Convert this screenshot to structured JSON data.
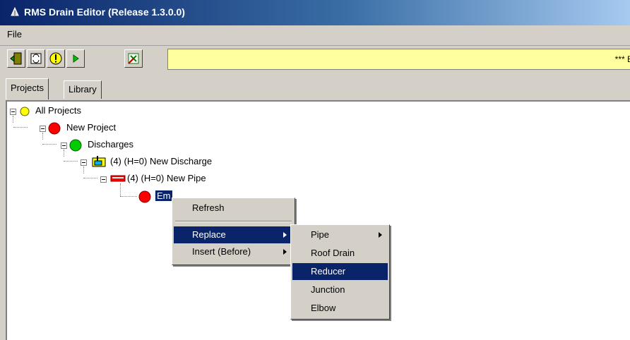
{
  "window": {
    "title": "RMS Drain Editor (Release 1.3.0.0)"
  },
  "menubar": {
    "file": "File"
  },
  "toolbar": {
    "message": "*** Er"
  },
  "tabs": [
    {
      "label": "Projects"
    },
    {
      "label": "Library"
    }
  ],
  "tree": {
    "all_projects": "All Projects",
    "new_project": "New Project",
    "discharges": "Discharges",
    "new_discharge": "(4) (H=0) New Discharge",
    "new_pipe": "(4) (H=0) New Pipe",
    "selected": "Em"
  },
  "context_menu": {
    "refresh": "Refresh",
    "replace": "Replace",
    "insert_before": "Insert (Before)"
  },
  "replace_submenu": {
    "pipe": "Pipe",
    "roof_drain": "Roof Drain",
    "reducer": "Reducer",
    "junction": "Junction",
    "elbow": "Elbow"
  },
  "colors": {
    "node_yellow": "#ffff00",
    "node_red": "#ff0000",
    "node_green": "#00cc00",
    "highlight": "#0a246a"
  }
}
